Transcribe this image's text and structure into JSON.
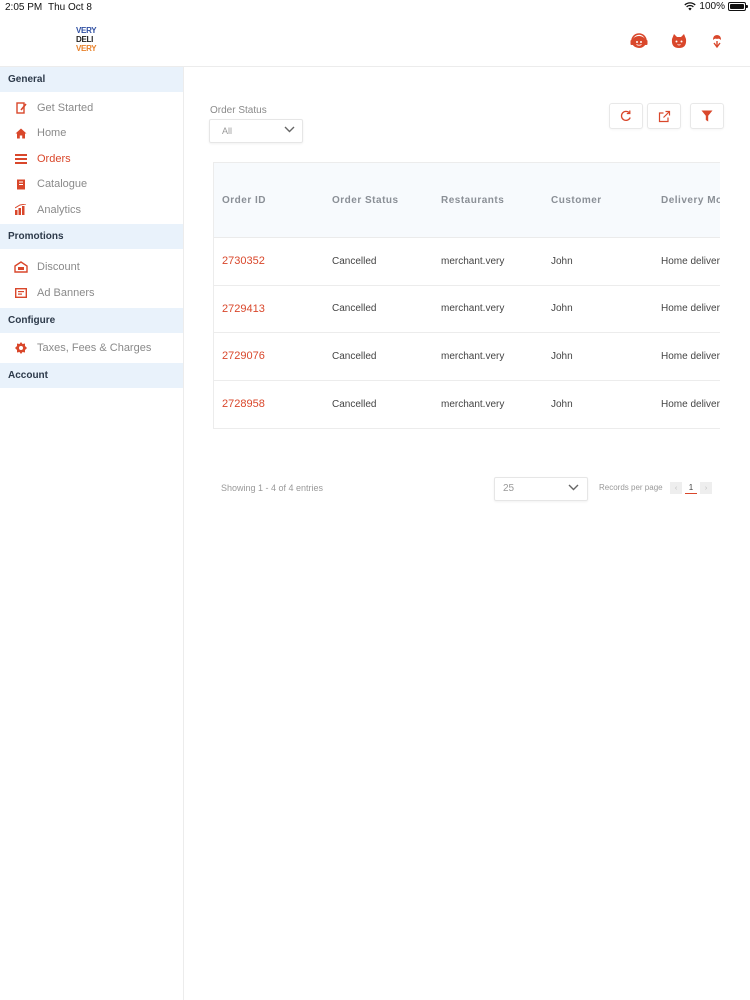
{
  "status_bar": {
    "time": "2:05 PM",
    "date": "Thu Oct 8",
    "battery": "100%"
  },
  "brand": {
    "logo_lines": [
      "VERY",
      "DELI",
      "VERY"
    ]
  },
  "header": {
    "icons": [
      "support-icon",
      "profile-face-icon",
      "store-location-icon"
    ]
  },
  "sidebar": {
    "sections": [
      {
        "title": "General",
        "items": [
          {
            "label": "Get Started",
            "icon": "edit-icon"
          },
          {
            "label": "Home",
            "icon": "home-icon"
          },
          {
            "label": "Orders",
            "icon": "list-icon",
            "active": true
          },
          {
            "label": "Catalogue",
            "icon": "book-icon"
          },
          {
            "label": "Analytics",
            "icon": "bar-chart-icon"
          }
        ]
      },
      {
        "title": "Promotions",
        "items": [
          {
            "label": "Discount",
            "icon": "discount-icon"
          },
          {
            "label": "Ad Banners",
            "icon": "banner-icon"
          }
        ]
      },
      {
        "title": "Configure",
        "items": [
          {
            "label": "Taxes, Fees & Charges",
            "icon": "settings-icon"
          }
        ]
      },
      {
        "title": "Account",
        "items": []
      }
    ]
  },
  "filter": {
    "label": "Order Status",
    "value": "All"
  },
  "toolbar": {
    "buttons": [
      "refresh-icon",
      "export-icon",
      "filter-icon"
    ]
  },
  "table": {
    "columns": [
      "Order ID",
      "Order Status",
      "Restaurants",
      "Customer",
      "Delivery Mo"
    ],
    "rows": [
      [
        "2730352",
        "Cancelled",
        "merchant.very",
        "John",
        "Home deliver"
      ],
      [
        "2729413",
        "Cancelled",
        "merchant.very",
        "John",
        "Home deliver"
      ],
      [
        "2729076",
        "Cancelled",
        "merchant.very",
        "John",
        "Home deliver"
      ],
      [
        "2728958",
        "Cancelled",
        "merchant.very",
        "John",
        "Home deliver"
      ]
    ]
  },
  "footer": {
    "showing": "Showing 1 - 4 of 4 entries",
    "page_size": "25",
    "records_label": "Records per page",
    "current_page": "1",
    "prev": "‹",
    "next": "›"
  },
  "colors": {
    "accent": "#d9472b",
    "section_bg": "#e9f2fb",
    "logo_blue": "#2f4fa2",
    "logo_orange": "#e8812a"
  }
}
